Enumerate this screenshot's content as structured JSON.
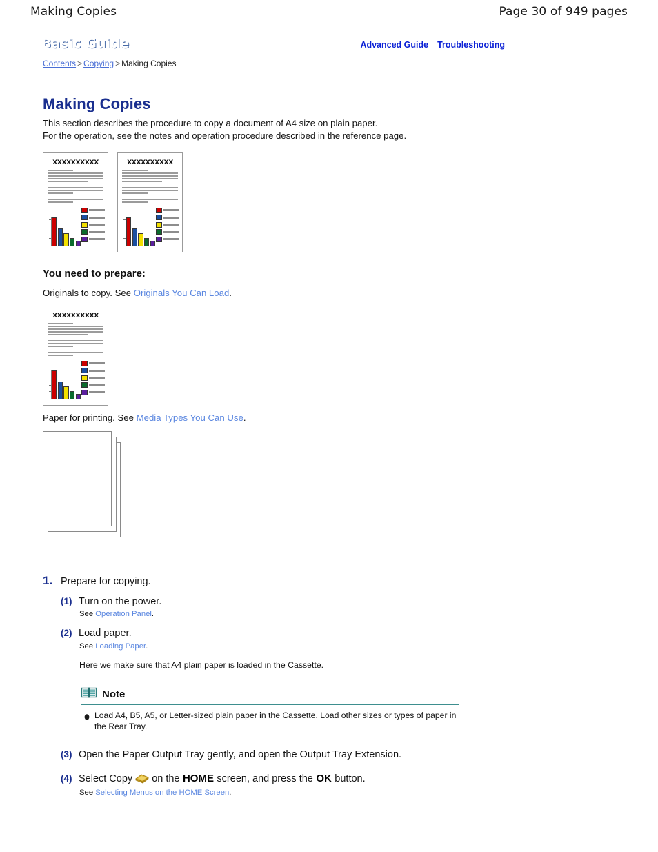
{
  "page_header": {
    "title": "Making Copies",
    "page_info": "Page 30 of 949 pages"
  },
  "banner": {
    "brand": "Basic Guide",
    "links": [
      {
        "label": "Advanced Guide",
        "marker": "white-square-icon"
      },
      {
        "label": "Troubleshooting",
        "marker": "white-square-icon"
      }
    ],
    "gradient_top": "#2f6fd0",
    "gradient_bottom": "#cfe2fa",
    "link_color": "#0b21d6"
  },
  "breadcrumb": {
    "items": [
      {
        "label": "Contents",
        "is_link": true
      },
      {
        "label": "Copying",
        "is_link": true
      },
      {
        "label": "Making Copies",
        "is_link": false
      }
    ],
    "separator": ">"
  },
  "document": {
    "title": "Making Copies",
    "title_color": "#1a2f8f",
    "intro_line_1": "This section describes the procedure to copy a document of A4 size on plain paper.",
    "intro_line_2": "For the operation, see the notes and operation procedure described in the reference page."
  },
  "thumbnails": {
    "heading_text": "XXXXXXXXXX",
    "bar_colors": [
      "#cc0000",
      "#1a4fa0",
      "#f2e000",
      "#0b6b2d",
      "#5b1f9e"
    ],
    "bar_heights_pct": [
      95,
      58,
      40,
      22,
      14
    ],
    "count_top_row": 2,
    "count_single": 1
  },
  "prepare": {
    "heading": "You need to prepare:",
    "originals_prefix": "Originals to copy. See",
    "originals_link": "Originals You Can Load",
    "originals_suffix": ".",
    "paper_prefix": "Paper for printing. See",
    "paper_link": "Media Types You Can Use",
    "paper_suffix": ".",
    "paper_sheet_count": 3
  },
  "steps": [
    {
      "number": "1.",
      "text": "Prepare for copying.",
      "substeps": [
        {
          "number": "(1)",
          "text": "Turn on the power.",
          "see_prefix": "See",
          "see_link": "Operation Panel",
          "see_suffix": "."
        },
        {
          "number": "(2)",
          "text": "Load paper.",
          "see_prefix": "See",
          "see_link": "Loading Paper",
          "see_suffix": ".",
          "extra": "Here we make sure that A4 plain paper is loaded in the Cassette."
        },
        {
          "number": "(3)",
          "text": "Open the Paper Output Tray gently, and open the Output Tray Extension."
        },
        {
          "number": "(4)",
          "text_part_1": "Select Copy",
          "icon": "copy-icon",
          "text_part_2": "on the",
          "bold_1": "HOME",
          "text_part_3": "screen, and press the",
          "bold_2": "OK",
          "text_part_4": "button.",
          "see_prefix": "See",
          "see_link": "Selecting Menus on the HOME Screen",
          "see_suffix": "."
        }
      ]
    }
  ],
  "note": {
    "icon": "open-book-icon",
    "title": "Note",
    "rule_color": "#3e8f8f",
    "items": [
      "Load A4, B5, A5, or Letter-sized plain paper in the Cassette. Load other sizes or types of paper in the Rear Tray."
    ]
  }
}
